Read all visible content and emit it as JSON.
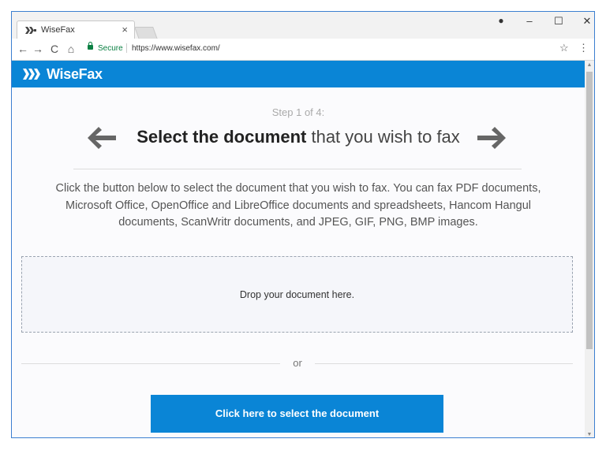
{
  "browser": {
    "tab_title": "WiseFax",
    "tab_close": "×",
    "window_controls": {
      "user": "●",
      "minimize": "–",
      "maximize": "☐",
      "close": "✕"
    },
    "nav": {
      "back": "←",
      "forward": "→",
      "reload": "C",
      "home": "⌂"
    },
    "security_label": "Secure",
    "url": "https://www.wisefax.com/",
    "bookmark": "☆",
    "menu": "⋮",
    "scroll_up": "▲",
    "scroll_down": "▼"
  },
  "site": {
    "brand": "WiseFax",
    "brand_color": "#0a85d6"
  },
  "wizard": {
    "step_label": "Step 1 of 4:",
    "heading_bold": "Select the document",
    "heading_rest": " that you wish to fax",
    "description": "Click the button below to select the document that you wish to fax. You can fax PDF documents, Microsoft Office, OpenOffice and LibreOffice documents and spreadsheets, Hancom Hangul documents, ScanWritr documents, and JPEG, GIF, PNG, BMP images.",
    "dropzone_text": "Drop your document here.",
    "or_text": "or",
    "select_button": "Click here to select the document"
  },
  "icons": {
    "prev": "arrow-left-icon",
    "next": "arrow-right-icon",
    "logo": "wisefax-logo-icon",
    "lock": "lock-icon"
  }
}
